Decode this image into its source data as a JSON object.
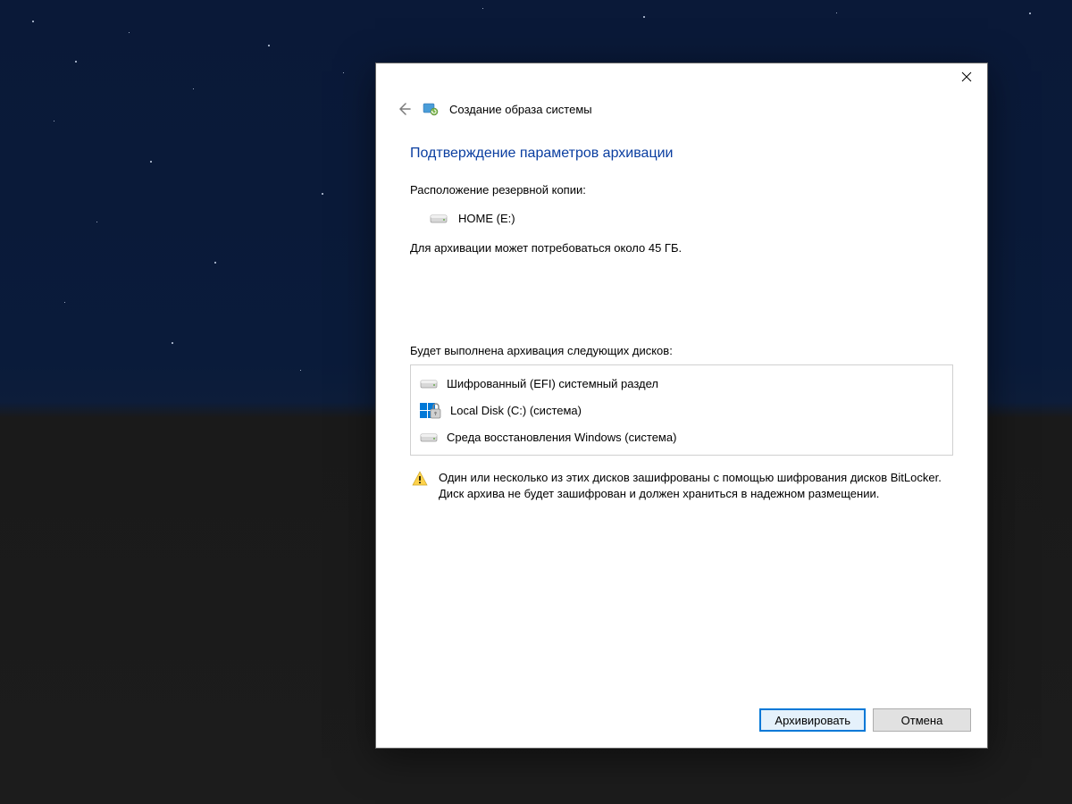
{
  "header": {
    "title": "Создание образа системы"
  },
  "page": {
    "heading": "Подтверждение параметров архивации",
    "location_label": "Расположение резервной копии:",
    "location_name": "HOME (E:)",
    "size_estimate": "Для архивации может потребоваться около 45 ГБ.",
    "disks_label": "Будет выполнена архивация следующих дисков:",
    "disks": [
      {
        "name": "Шифрованный (EFI) системный раздел",
        "locked": false
      },
      {
        "name": "Local Disk (C:) (система)",
        "locked": true
      },
      {
        "name": "Среда восстановления Windows (система)",
        "locked": false
      }
    ],
    "warning": "Один или несколько из этих дисков зашифрованы с помощью шифрования дисков BitLocker. Диск архива не будет зашифрован и должен храниться в надежном размещении."
  },
  "footer": {
    "primary_label": "Архивировать",
    "secondary_label": "Отмена"
  }
}
